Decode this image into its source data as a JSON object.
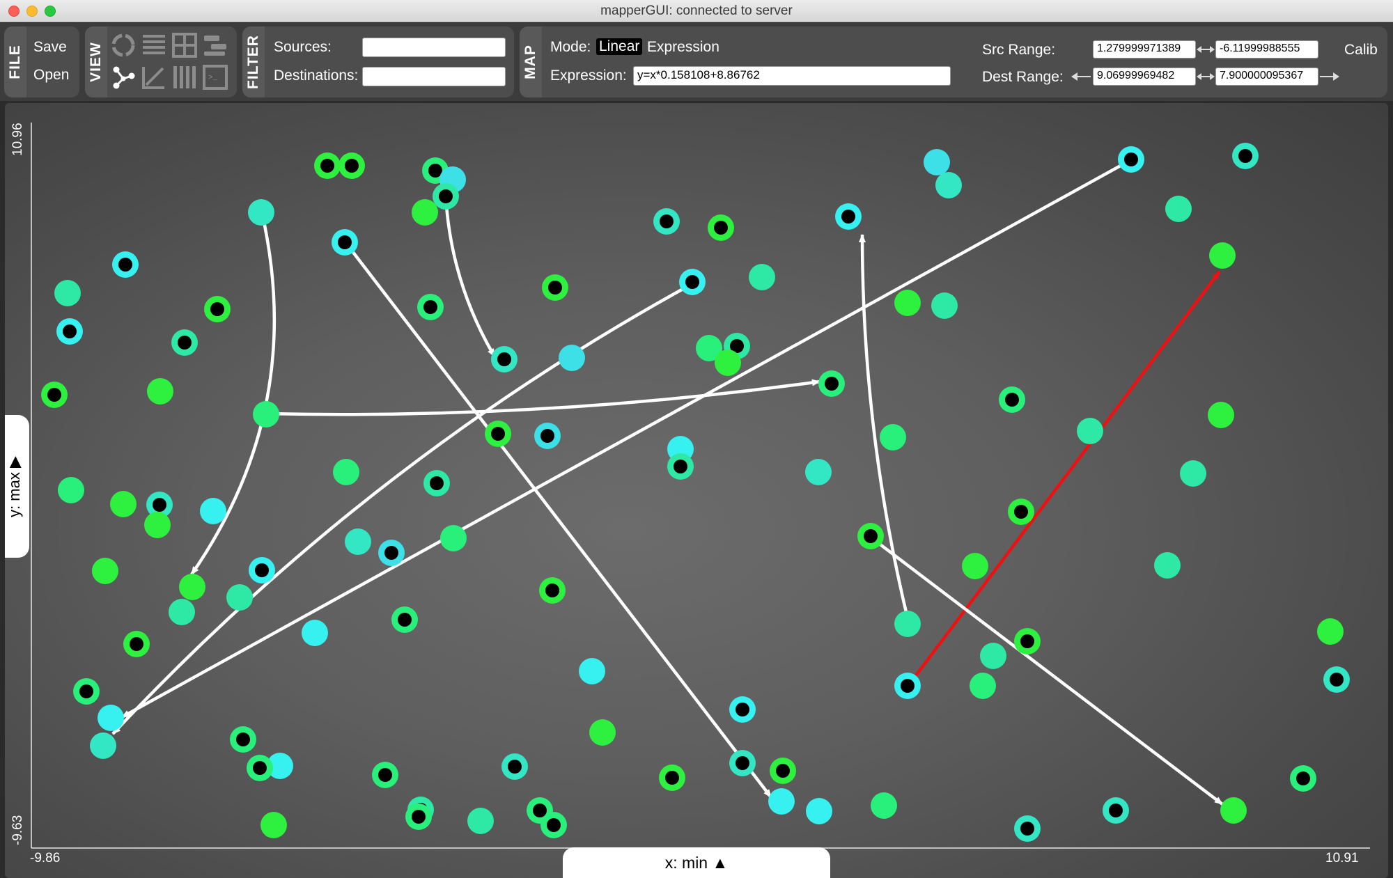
{
  "window": {
    "title": "mapperGUI: connected to server"
  },
  "toolbar": {
    "file": {
      "label": "FILE",
      "save": "Save",
      "open": "Open"
    },
    "view": {
      "label": "VIEW",
      "icons": [
        "chord-view-icon",
        "list-view-icon",
        "grid-view-icon",
        "hive-view-icon",
        "graph-view-icon",
        "balloon-view-icon",
        "parallel-view-icon",
        "console-view-icon"
      ]
    },
    "filter": {
      "label": "FILTER",
      "sources_label": "Sources:",
      "sources_value": "",
      "destinations_label": "Destinations:",
      "destinations_value": ""
    },
    "map": {
      "label": "MAP",
      "mode_label": "Mode:",
      "mode_linear": "Linear",
      "mode_expression": "Expression",
      "expression_label": "Expression:",
      "expression_value": "y=x*0.158108+8.86762",
      "src_range_label": "Src Range:",
      "src_min": "1.279999971389",
      "src_max": "-6.11999988555",
      "dest_range_label": "Dest Range:",
      "dest_min": "9.06999969482",
      "dest_max": "7.900000095367",
      "calib_label": "Calib"
    }
  },
  "plot": {
    "y_axis_max": "10.96",
    "y_axis_min": "-9.63",
    "x_axis_min": "-9.86",
    "x_axis_max": "10.91",
    "y_selector": "y: max ▶",
    "x_selector": "x: min ▲",
    "colors": {
      "arrow": "#ffffff",
      "selected_arrow": "#ee1111"
    }
  }
}
